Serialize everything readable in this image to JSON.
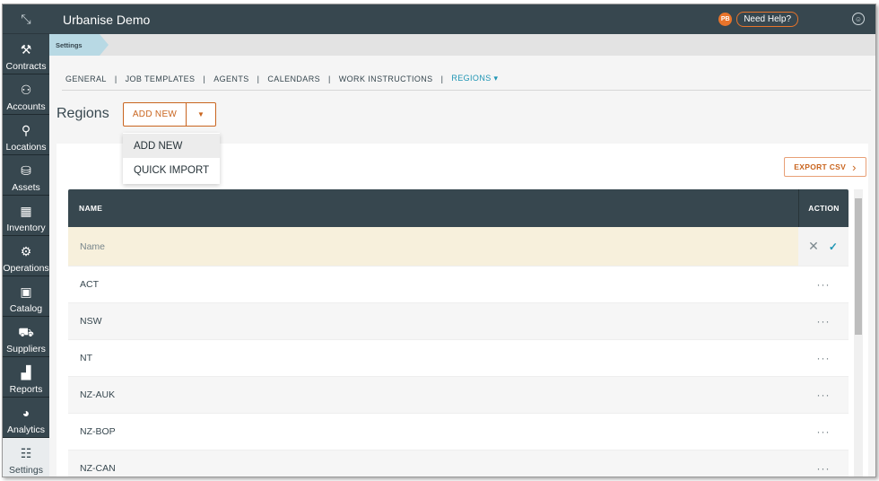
{
  "app": {
    "title": "Urbanise Demo",
    "help_label": "Need Help?",
    "help_badge": "PB"
  },
  "sidebar": {
    "items": [
      {
        "label": "Contracts",
        "icon": "wrench-icon",
        "glyph": "⚒"
      },
      {
        "label": "Accounts",
        "icon": "accounts-icon",
        "glyph": "⚇"
      },
      {
        "label": "Locations",
        "icon": "pin-icon",
        "glyph": "⚲"
      },
      {
        "label": "Assets",
        "icon": "assets-icon",
        "glyph": "⛁"
      },
      {
        "label": "Inventory",
        "icon": "inventory-icon",
        "glyph": "▦"
      },
      {
        "label": "Operations",
        "icon": "gears-icon",
        "glyph": "⚙"
      },
      {
        "label": "Catalog",
        "icon": "catalog-icon",
        "glyph": "▣"
      },
      {
        "label": "Suppliers",
        "icon": "truck-icon",
        "glyph": "⛟"
      },
      {
        "label": "Reports",
        "icon": "bar-chart-icon",
        "glyph": "▟"
      },
      {
        "label": "Analytics",
        "icon": "pie-chart-icon",
        "glyph": "◕"
      },
      {
        "label": "Settings",
        "icon": "sliders-icon",
        "glyph": "☷"
      }
    ]
  },
  "breadcrumb": {
    "label": "Settings"
  },
  "tabs": [
    {
      "label": "GENERAL"
    },
    {
      "label": "JOB TEMPLATES"
    },
    {
      "label": "AGENTS"
    },
    {
      "label": "CALENDARS"
    },
    {
      "label": "WORK INSTRUCTIONS"
    },
    {
      "label": "REGIONS ▾"
    }
  ],
  "tab_separator": "|",
  "page": {
    "title": "Regions",
    "add_new_label": "ADD NEW",
    "dropdown": [
      "ADD NEW",
      "QUICK IMPORT"
    ],
    "export_label": "EXPORT CSV"
  },
  "table": {
    "headers": {
      "name": "NAME",
      "action": "ACTION"
    },
    "edit_placeholder": "Name",
    "rows": [
      "ACT",
      "NSW",
      "NT",
      "NZ-AUK",
      "NZ-BOP",
      "NZ-CAN"
    ],
    "row_action": "···"
  }
}
